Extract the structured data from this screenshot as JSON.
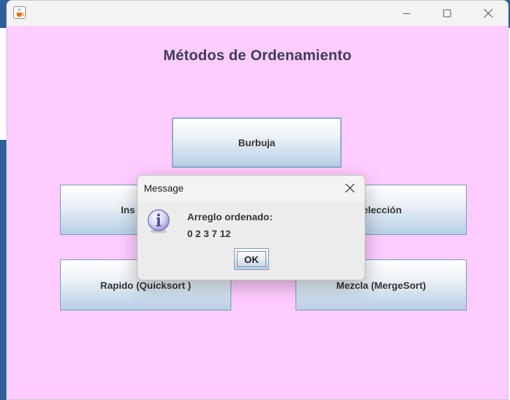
{
  "window": {
    "title": "",
    "heading": "Métodos de Ordenamiento",
    "app_icon": "java-cup-icon",
    "controls": {
      "minimize_icon": "minimize-icon",
      "maximize_icon": "maximize-icon",
      "close_icon": "close-icon"
    }
  },
  "buttons": {
    "burbuja": "Burbuja",
    "insercion_visible": "Ins",
    "seleccion_visible": "elección",
    "rapido": "Rapido (Quicksort )",
    "mezcla": "Mezcla (MergeSort)"
  },
  "dialog": {
    "title": "Message",
    "icon": "information-icon",
    "message_line1": "Arreglo ordenado:",
    "message_line2": "0 2 3 7 12",
    "ok_label": "OK",
    "close_icon": "close-icon"
  },
  "colors": {
    "content_background": "#ffccff",
    "titlebar": "#f3f3f3",
    "desktop": "#2f5f9a"
  }
}
